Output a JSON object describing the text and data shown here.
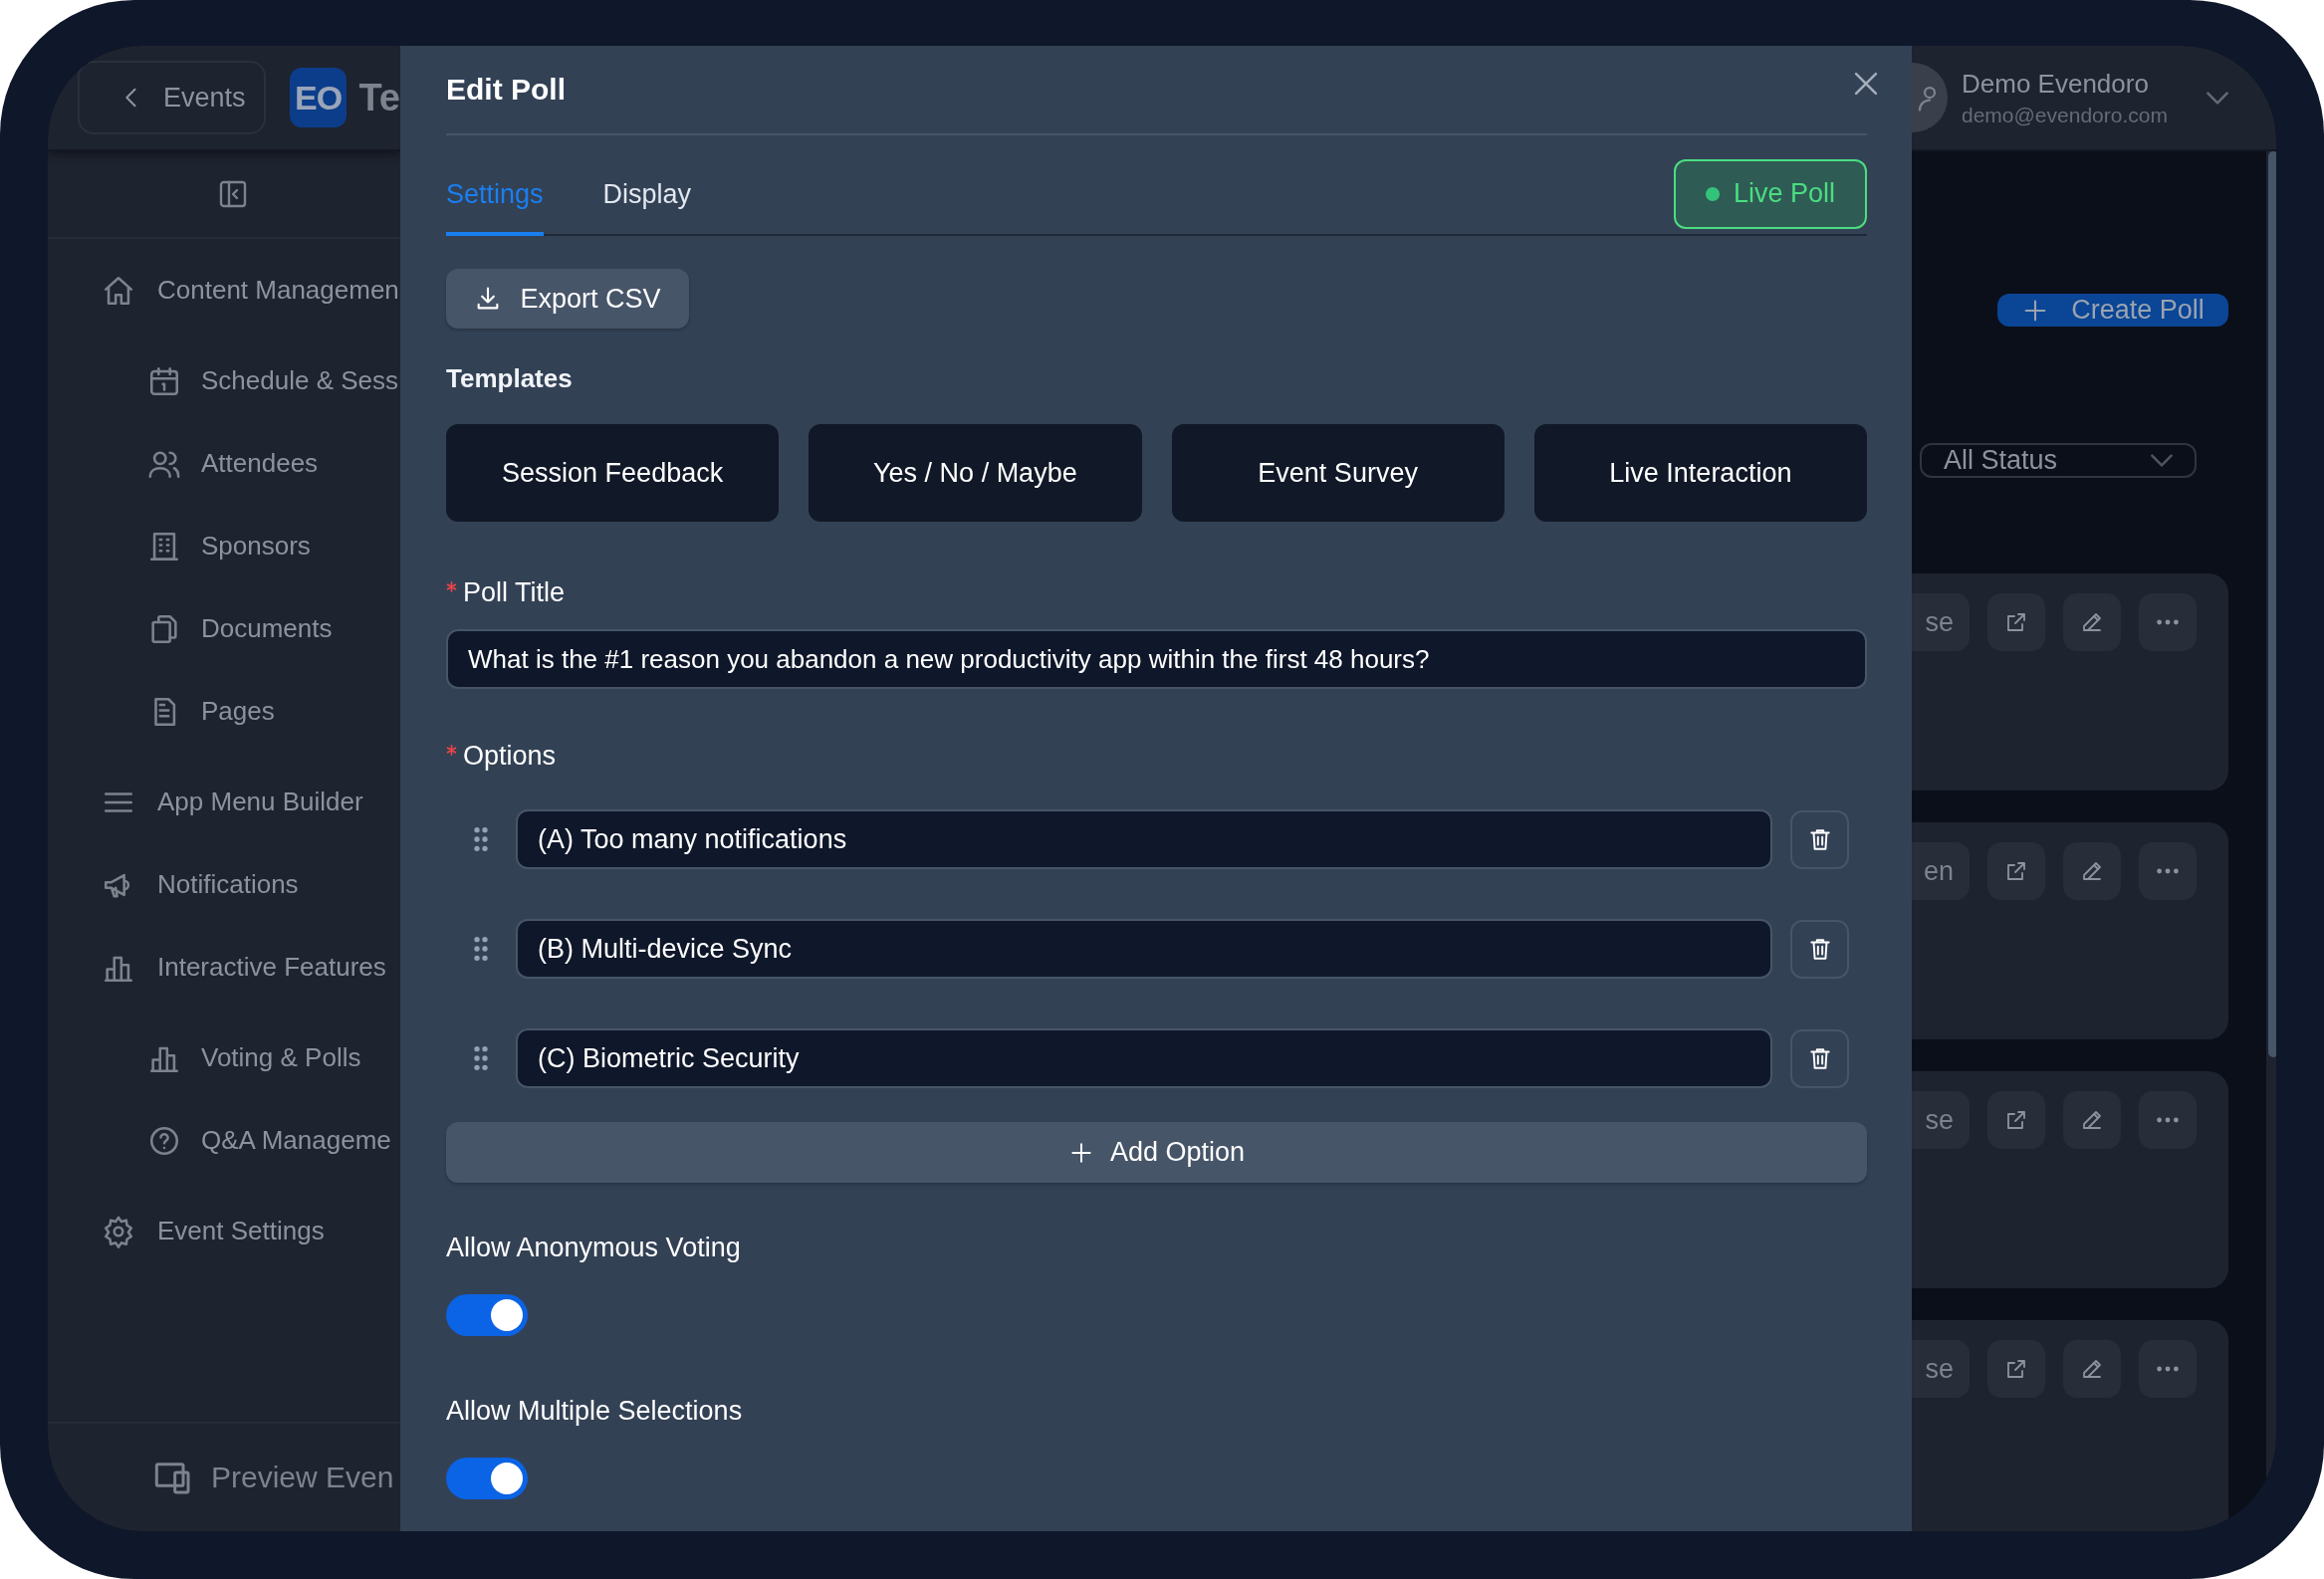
{
  "header": {
    "back_button": "Events",
    "logo": "EO",
    "brand": "Te",
    "user": {
      "name": "Demo Evendoro",
      "email": "demo@evendoro.com"
    }
  },
  "sidebar": {
    "items": [
      {
        "label": "Content Managemen",
        "children": [
          {
            "label": "Schedule & Sess"
          },
          {
            "label": "Attendees"
          },
          {
            "label": "Sponsors"
          },
          {
            "label": "Documents"
          },
          {
            "label": "Pages"
          }
        ]
      },
      {
        "label": "App Menu Builder"
      },
      {
        "label": "Notifications"
      },
      {
        "label": "Interactive Features",
        "children": [
          {
            "label": "Voting & Polls"
          },
          {
            "label": "Q&A Manageme"
          }
        ]
      },
      {
        "label": "Event Settings"
      }
    ],
    "footer": "Preview Even"
  },
  "modal": {
    "title": "Edit Poll",
    "tabs": [
      {
        "label": "Settings",
        "selected": true
      },
      {
        "label": "Display",
        "selected": false
      }
    ],
    "live_button": "Live Poll",
    "export_button": "Export CSV",
    "templates_label": "Templates",
    "templates": [
      "Session Feedback",
      "Yes / No / Maybe",
      "Event Survey",
      "Live Interaction"
    ],
    "poll_title": {
      "label": "Poll Title",
      "required": true,
      "value": "What is the #1 reason you abandon a new productivity app within the first 48 hours?"
    },
    "options": {
      "label": "Options",
      "required": true,
      "items": [
        "(A) Too many notifications",
        "(B) Multi-device Sync",
        "(C) Biometric Security"
      ]
    },
    "add_option": "Add Option",
    "settings": [
      {
        "label": "Allow Anonymous Voting",
        "on": true
      },
      {
        "label": "Allow Multiple Selections",
        "on": true
      }
    ]
  },
  "main": {
    "create_button": "Create Poll",
    "status_filter": "All Status",
    "cards": [
      {
        "status_fragment": "se"
      },
      {
        "status_fragment": "en"
      },
      {
        "status_fragment": "se"
      },
      {
        "status_fragment": "se"
      }
    ]
  }
}
